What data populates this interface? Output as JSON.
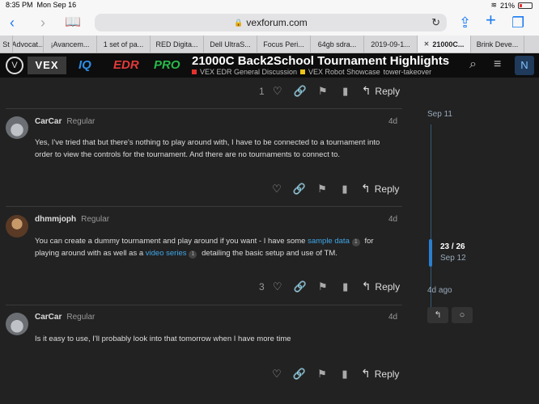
{
  "status": {
    "time": "8:35 PM",
    "date": "Mon Sep 16",
    "battery": "21%"
  },
  "browser": {
    "url": "vexforum.com",
    "tabs": [
      {
        "label": "St",
        "active": false
      },
      {
        "label": "Advocat...",
        "active": false
      },
      {
        "label": "¡Avancem...",
        "active": false
      },
      {
        "label": "1 set of pa...",
        "active": false
      },
      {
        "label": "RED Digita...",
        "active": false
      },
      {
        "label": "Dell UltraS...",
        "active": false
      },
      {
        "label": "Focus Peri...",
        "active": false
      },
      {
        "label": "64gb sdra...",
        "active": false
      },
      {
        "label": "2019-09-1...",
        "active": false
      },
      {
        "label": "21000C...",
        "active": true
      },
      {
        "label": "Brink Deve...",
        "active": false
      }
    ]
  },
  "header": {
    "brands": {
      "iq": "IQ",
      "edr": "EDR",
      "pro": "PRO",
      "vex": "VEX"
    },
    "topic_title": "21000C Back2School Tournament Highlights",
    "category1": "VEX EDR General Discussion",
    "category2": "VEX Robot Showcase",
    "tag": "tower-takeover",
    "cat1_color": "#e4322b",
    "cat2_color": "#f0c419",
    "user_initial": "N"
  },
  "posts": [
    {
      "likes": "1",
      "reply": "Reply"
    },
    {
      "username": "CarCar",
      "role": "Regular",
      "date": "4d",
      "text": "Yes, I've tried that but there's nothing to play around with, I have to be connected to a tournament into order to view the controls for the tournament. And there are no tournaments to connect to.",
      "reply": "Reply"
    },
    {
      "username": "dhmmjoph",
      "role": "Regular",
      "date": "4d",
      "text_before": "You can create a dummy tournament and play around if you want - I have some ",
      "link1": "sample data",
      "link1_count": "1",
      "text_mid": " for playing around with as well as a ",
      "link2": "video series",
      "link2_count": "1",
      "text_after": " detailing the basic setup and use of TM.",
      "likes": "3",
      "reply": "Reply"
    },
    {
      "username": "CarCar",
      "role": "Regular",
      "date": "4d",
      "text": "Is it easy to use, I'll probably look into that tomorrow when I have more time",
      "reply": "Reply"
    }
  ],
  "timeline": {
    "start_date": "Sep 11",
    "position": "23 / 26",
    "position_date": "Sep 12",
    "end_label": "4d ago"
  }
}
